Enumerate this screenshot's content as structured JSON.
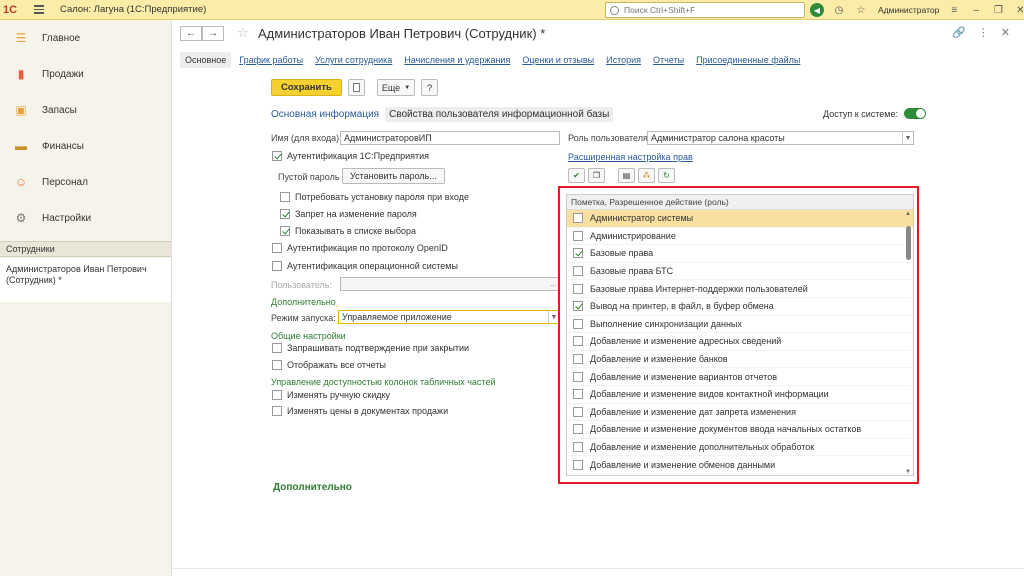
{
  "app": {
    "logo": "1С",
    "title": "Салон: Лагуна  (1С:Предприятие)",
    "search_placeholder": "Поиск Ctrl+Shift+F",
    "user": "Администратор"
  },
  "sidebar": {
    "items": [
      {
        "label": "Главное",
        "icon": "home-icon",
        "color": "#e8a33a"
      },
      {
        "label": "Продажи",
        "icon": "chart-icon",
        "color": "#e85d3a"
      },
      {
        "label": "Запасы",
        "icon": "box-icon",
        "color": "#e8a33a"
      },
      {
        "label": "Финансы",
        "icon": "wallet-icon",
        "color": "#c8902a"
      },
      {
        "label": "Персонал",
        "icon": "people-icon",
        "color": "#e8773a"
      },
      {
        "label": "Настройки",
        "icon": "gear-icon",
        "color": "#777777"
      }
    ],
    "section": "Сотрудники",
    "open_doc": "Администраторов Иван Петрович (Сотрудник) *"
  },
  "doc": {
    "title": "Администраторов Иван Петрович (Сотрудник) *",
    "tabs": [
      "Основное",
      "График работы",
      "Услуги сотрудника",
      "Начисления и удержания",
      "Оценки и отзывы",
      "История",
      "Отчеты",
      "Присоединенные файлы"
    ]
  },
  "toolbar": {
    "save": "Сохранить",
    "more": "Еще",
    "help": "?"
  },
  "section_tabs": [
    "Основная информация",
    "Свойства пользователя информационной базы"
  ],
  "access_label": "Доступ к системе:",
  "form": {
    "login_label": "Имя (для входа):",
    "login_value": "АдминистраторовИП",
    "role_label": "Роль пользователя:",
    "role_value": "Администратор салона красоты",
    "auth_1c": "Аутентификация 1С:Предприятия",
    "empty_pwd": "Пустой пароль",
    "set_pwd": "Установить пароль...",
    "require_pwd": "Потребовать установку пароля при входе",
    "deny_pwd_change": "Запрет на изменение пароля",
    "show_in_list": "Показывать в списке выбора",
    "openid": "Аутентификация по протоколу OpenID",
    "os_auth": "Аутентификация операционной системы",
    "user_label": "Пользователь:",
    "extra_header": "Дополнительно",
    "mode_label": "Режим запуска:",
    "mode_value": "Управляемое приложение",
    "general_header": "Общие настройки",
    "confirm_close": "Запрашивать подтверждение при закрытии",
    "show_reports": "Отображать все отчеты",
    "columns_header": "Управление доступностью колонок табличных частей",
    "manual_discount": "Изменять ручную скидку",
    "change_prices": "Изменять цены в документах продажи",
    "adv_rights": "Расширенная настройка прав",
    "bottom_extra": "Дополнительно"
  },
  "rights": {
    "header": "Пометка, Разрешенное действие (роль)",
    "rows": [
      {
        "label": "Администратор системы",
        "checked": false,
        "selected": true
      },
      {
        "label": "Администрирование",
        "checked": false,
        "selected": false
      },
      {
        "label": "Базовые права",
        "checked": true,
        "selected": false
      },
      {
        "label": "Базовые права БТС",
        "checked": false,
        "selected": false
      },
      {
        "label": "Базовые права Интернет-поддержки пользователей",
        "checked": false,
        "selected": false
      },
      {
        "label": "Вывод на принтер, в файл, в буфер обмена",
        "checked": true,
        "selected": false
      },
      {
        "label": "Выполнение синхронизации данных",
        "checked": false,
        "selected": false
      },
      {
        "label": "Добавление и изменение адресных сведений",
        "checked": false,
        "selected": false
      },
      {
        "label": "Добавление и изменение банков",
        "checked": false,
        "selected": false
      },
      {
        "label": "Добавление и изменение вариантов отчетов",
        "checked": false,
        "selected": false
      },
      {
        "label": "Добавление и изменение видов контактной информации",
        "checked": false,
        "selected": false
      },
      {
        "label": "Добавление и изменение дат запрета изменения",
        "checked": false,
        "selected": false
      },
      {
        "label": "Добавление и изменение документов ввода начальных остатков",
        "checked": false,
        "selected": false
      },
      {
        "label": "Добавление и изменение дополнительных обработок",
        "checked": false,
        "selected": false
      },
      {
        "label": "Добавление и изменение обменов данными",
        "checked": false,
        "selected": false
      }
    ]
  }
}
